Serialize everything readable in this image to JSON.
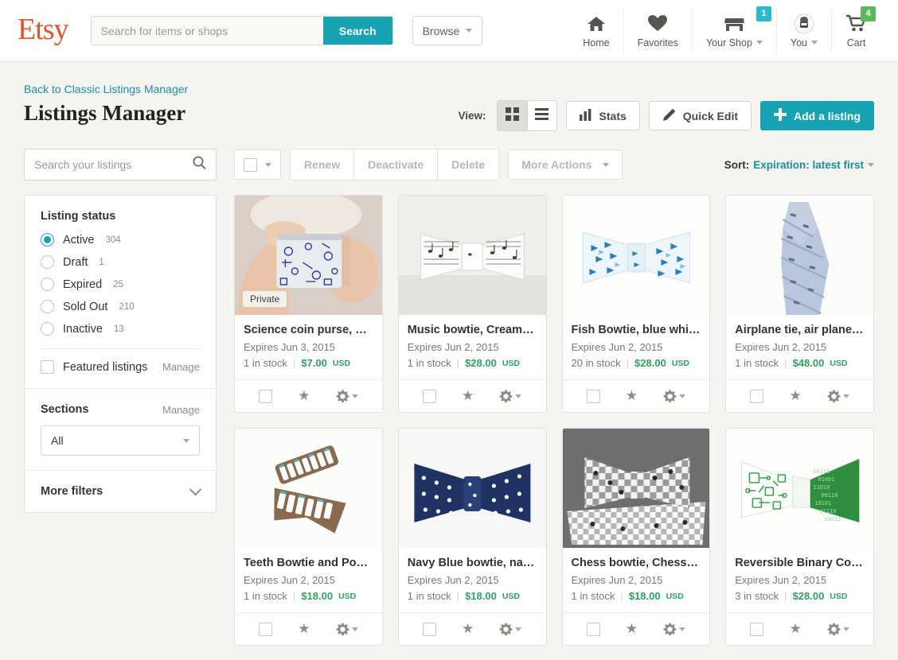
{
  "header": {
    "logo": "Etsy",
    "search": {
      "placeholder": "Search for items or shops",
      "value": "",
      "button": "Search"
    },
    "browse": "Browse",
    "nav": [
      {
        "label": "Home",
        "icon": "home-icon",
        "badge": null,
        "caret": false
      },
      {
        "label": "Favorites",
        "icon": "heart-icon",
        "badge": null,
        "caret": false
      },
      {
        "label": "Your Shop",
        "icon": "shop-icon",
        "badge": "1",
        "badge_color": "#2eb8cc",
        "caret": true
      },
      {
        "label": "You",
        "icon": "avatar-icon",
        "badge": null,
        "caret": true
      },
      {
        "label": "Cart",
        "icon": "cart-icon",
        "badge": "4",
        "badge_color": "#5cb85c",
        "caret": false
      }
    ]
  },
  "page": {
    "back_link": "Back to Classic Listings Manager",
    "title": "Listings Manager",
    "view_label": "View:",
    "view_grid_icon": "grid-view-icon",
    "view_list_icon": "list-view-icon",
    "active_view": "grid",
    "stats_button": "Stats",
    "quick_edit_button": "Quick Edit",
    "add_listing_button": "Add a listing"
  },
  "sidebar": {
    "search_placeholder": "Search your listings",
    "search_value": "",
    "listing_status_title": "Listing status",
    "statuses": [
      {
        "label": "Active",
        "count": "304",
        "selected": true
      },
      {
        "label": "Draft",
        "count": "1",
        "selected": false
      },
      {
        "label": "Expired",
        "count": "25",
        "selected": false
      },
      {
        "label": "Sold Out",
        "count": "210",
        "selected": false
      },
      {
        "label": "Inactive",
        "count": "13",
        "selected": false
      }
    ],
    "featured_label": "Featured listings",
    "featured_manage": "Manage",
    "sections_title": "Sections",
    "sections_manage": "Manage",
    "sections_value": "All",
    "more_filters": "More filters"
  },
  "toolbar": {
    "select_all_checked": false,
    "renew": "Renew",
    "deactivate": "Deactivate",
    "delete": "Delete",
    "more_actions": "More Actions",
    "sort_label": "Sort:",
    "sort_value": "Expiration: latest first"
  },
  "listings": [
    {
      "title": "Science coin purse, sci…",
      "expires": "Expires Jun 3, 2015",
      "stock": "1 in stock",
      "price": "$7.00",
      "currency": "USD",
      "badge": "Private",
      "image": "science-coin-purse"
    },
    {
      "title": "Music bowtie, Cream b…",
      "expires": "Expires Jun 2, 2015",
      "stock": "1 in stock",
      "price": "$28.00",
      "currency": "USD",
      "badge": null,
      "image": "music-bowtie"
    },
    {
      "title": "Fish Bowtie, blue white…",
      "expires": "Expires Jun 2, 2015",
      "stock": "20 in stock",
      "price": "$28.00",
      "currency": "USD",
      "badge": null,
      "image": "fish-bowtie"
    },
    {
      "title": "Airplane tie, air plane t…",
      "expires": "Expires Jun 2, 2015",
      "stock": "1 in stock",
      "price": "$48.00",
      "currency": "USD",
      "badge": null,
      "image": "airplane-tie"
    },
    {
      "title": "Teeth Bowtie and Pock…",
      "expires": "Expires Jun 2, 2015",
      "stock": "1 in stock",
      "price": "$18.00",
      "currency": "USD",
      "badge": null,
      "image": "teeth-bowtie"
    },
    {
      "title": "Navy Blue bowtie, navy…",
      "expires": "Expires Jun 2, 2015",
      "stock": "1 in stock",
      "price": "$18.00",
      "currency": "USD",
      "badge": null,
      "image": "navy-blue-bowtie"
    },
    {
      "title": "Chess bowtie, Chess po…",
      "expires": "Expires Jun 2, 2015",
      "stock": "1 in stock",
      "price": "$18.00",
      "currency": "USD",
      "badge": null,
      "image": "chess-bowtie"
    },
    {
      "title": "Reversible Binary Com…",
      "expires": "Expires Jun 2, 2015",
      "stock": "3 in stock",
      "price": "$28.00",
      "currency": "USD",
      "badge": null,
      "image": "binary-bowtie"
    }
  ],
  "colors": {
    "brand_orange": "#e2552a",
    "teal": "#18a3b5",
    "link_blue": "#1d8ca3",
    "price_green": "#30a161",
    "page_bg": "#f4f4f0"
  }
}
